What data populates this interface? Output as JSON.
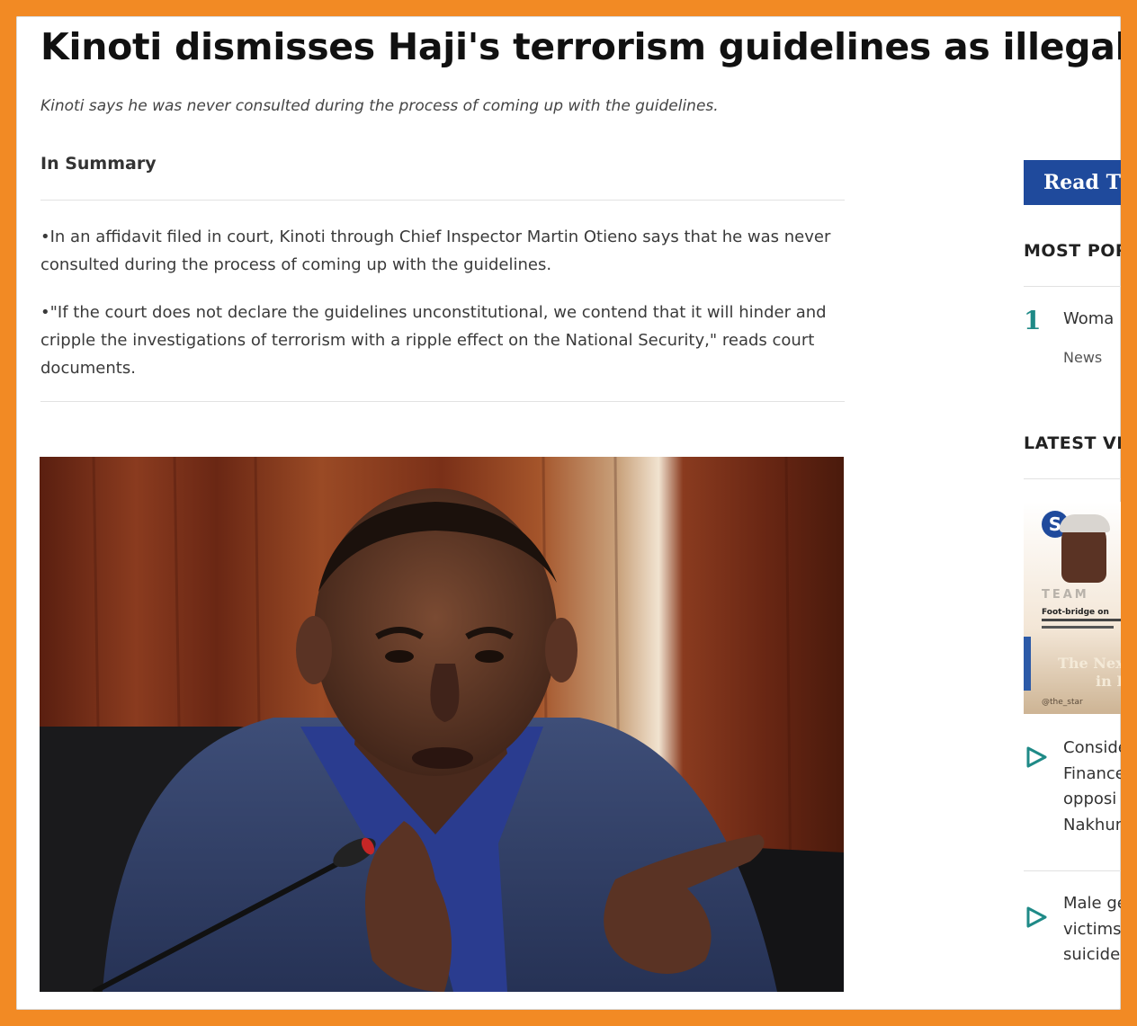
{
  "article": {
    "title": "Kinoti dismisses Haji's terrorism guidelines as illegal",
    "subtitle": "Kinoti says he was never consulted during the process of coming up with the guidelines.",
    "summary_heading": "In Summary",
    "summary": [
      "•In an affidavit filed in court, Kinoti through Chief Inspector Martin Otieno says that he was never consulted during the process of coming up with the guidelines.",
      "•\"If the court does not declare the guidelines unconstitutional, we contend that it will hinder and cripple the investigations of terrorism with a ripple effect on the National Security,\" reads court documents."
    ]
  },
  "sidebar": {
    "read_button": "Read Th",
    "most_popular_heading": "MOST POP",
    "popular": {
      "rank": "1",
      "title": "Woma",
      "tag": "News"
    },
    "latest_videos_heading": "LATEST VID",
    "thumbnail": {
      "badge": "S",
      "brand": "TEAM",
      "headline": "Foot-bridge on",
      "overlay": "The Nex",
      "overlay2": "in R",
      "handle": "@the_star"
    },
    "videos": [
      {
        "lines": [
          "Conside",
          "Finance",
          "opposi",
          "Nakhur"
        ]
      },
      {
        "lines": [
          "Male ge",
          "victims",
          "suicide"
        ]
      }
    ]
  },
  "colors": {
    "frame_orange": "#f28a24",
    "brand_blue": "#1f4a9c",
    "accent_teal": "#1f8a87"
  }
}
